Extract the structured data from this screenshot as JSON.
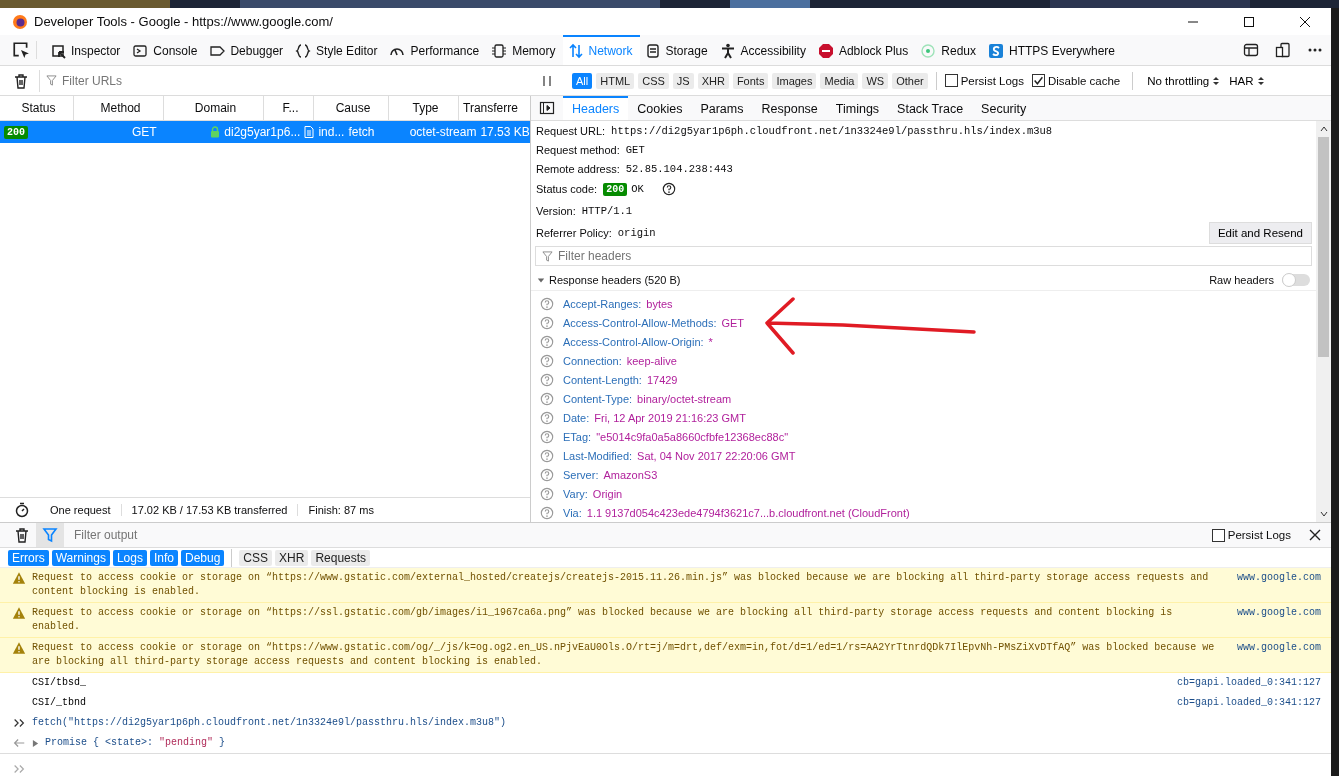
{
  "window": {
    "title": "Developer Tools - Google - https://www.google.com/"
  },
  "tool_tabs": [
    {
      "label": "Inspector",
      "selected": false
    },
    {
      "label": "Console",
      "selected": false
    },
    {
      "label": "Debugger",
      "selected": false
    },
    {
      "label": "Style Editor",
      "selected": false
    },
    {
      "label": "Performance",
      "selected": false
    },
    {
      "label": "Memory",
      "selected": false
    },
    {
      "label": "Network",
      "selected": true
    },
    {
      "label": "Storage",
      "selected": false
    },
    {
      "label": "Accessibility",
      "selected": false
    },
    {
      "label": "Adblock Plus",
      "selected": false
    },
    {
      "label": "Redux",
      "selected": false
    },
    {
      "label": "HTTPS Everywhere",
      "selected": false
    }
  ],
  "network_toolbar": {
    "filter": {
      "placeholder": "Filter URLs"
    },
    "type_filters": [
      {
        "label": "All",
        "selected": true
      },
      {
        "label": "HTML",
        "selected": false
      },
      {
        "label": "CSS",
        "selected": false
      },
      {
        "label": "JS",
        "selected": false
      },
      {
        "label": "XHR",
        "selected": false
      },
      {
        "label": "Fonts",
        "selected": false
      },
      {
        "label": "Images",
        "selected": false
      },
      {
        "label": "Media",
        "selected": false
      },
      {
        "label": "WS",
        "selected": false
      },
      {
        "label": "Other",
        "selected": false
      }
    ],
    "options": [
      {
        "label": "Persist Logs",
        "checked": false
      },
      {
        "label": "Disable cache",
        "checked": true
      }
    ],
    "throttling": "No throttling",
    "har": "HAR"
  },
  "request_table": {
    "columns": [
      "Status",
      "Method",
      "Domain",
      "F...",
      "Cause",
      "Type",
      "Transferre"
    ],
    "rows": [
      {
        "status": "200",
        "method": "GET",
        "domain": "di2g5yar1p6...",
        "file": "ind...",
        "cause": "fetch",
        "type": "octet-stream",
        "transferred": "17.53 KB",
        "selected": true
      }
    ]
  },
  "status_bar": [
    "One request",
    "17.02 KB / 17.53 KB transferred",
    "Finish: 87 ms"
  ],
  "details": {
    "tabs": [
      {
        "label": "Headers",
        "selected": true
      },
      {
        "label": "Cookies",
        "selected": false
      },
      {
        "label": "Params",
        "selected": false
      },
      {
        "label": "Response",
        "selected": false
      },
      {
        "label": "Timings",
        "selected": false
      },
      {
        "label": "Stack Trace",
        "selected": false
      },
      {
        "label": "Security",
        "selected": false
      }
    ],
    "summary": [
      {
        "kind": "text",
        "label": "Request URL:",
        "value": "https://di2g5yar1p6ph.cloudfront.net/1n3324e9l/passthru.hls/index.m3u8"
      },
      {
        "kind": "text",
        "label": "Request method:",
        "value": "GET"
      },
      {
        "kind": "text",
        "label": "Remote address:",
        "value": "52.85.104.238:443"
      },
      {
        "kind": "status",
        "label": "Status code:",
        "code": "200",
        "value": "OK"
      },
      {
        "kind": "text",
        "label": "Version:",
        "value": "HTTP/1.1"
      },
      {
        "kind": "text",
        "label": "Referrer Policy:",
        "value": "origin"
      }
    ],
    "edit_button": "Edit and Resend",
    "filter": {
      "placeholder": "Filter headers"
    },
    "response_headers": {
      "title": "Response headers (520 B)",
      "expanded": true
    },
    "raw_headers": {
      "label": "Raw headers",
      "on": false
    },
    "headers": [
      {
        "name": "Accept-Ranges:",
        "value": "bytes"
      },
      {
        "name": "Access-Control-Allow-Methods:",
        "value": "GET"
      },
      {
        "name": "Access-Control-Allow-Origin:",
        "value": "*"
      },
      {
        "name": "Connection:",
        "value": "keep-alive"
      },
      {
        "name": "Content-Length:",
        "value": "17429"
      },
      {
        "name": "Content-Type:",
        "value": "binary/octet-stream"
      },
      {
        "name": "Date:",
        "value": "Fri, 12 Apr 2019 21:16:23 GMT"
      },
      {
        "name": "ETag:",
        "value": "\"e5014c9fa0a5a8660cfbfe12368ec88c\""
      },
      {
        "name": "Last-Modified:",
        "value": "Sat, 04 Nov 2017 22:20:06 GMT"
      },
      {
        "name": "Server:",
        "value": "AmazonS3"
      },
      {
        "name": "Vary:",
        "value": "Origin"
      },
      {
        "name": "Via:",
        "value": "1.1 9137d054c423ede4794f3621c7...b.cloudfront.net (CloudFront)"
      }
    ]
  },
  "console": {
    "filter": {
      "placeholder": "Filter output"
    },
    "persist_logs": {
      "label": "Persist Logs",
      "checked": false
    },
    "level_filters": [
      {
        "label": "Errors",
        "selected": true
      },
      {
        "label": "Warnings",
        "selected": true
      },
      {
        "label": "Logs",
        "selected": true
      },
      {
        "label": "Info",
        "selected": true
      },
      {
        "label": "Debug",
        "selected": true
      },
      {
        "label": "CSS",
        "selected": false
      },
      {
        "label": "XHR",
        "selected": false
      },
      {
        "label": "Requests",
        "selected": false
      }
    ],
    "messages": [
      {
        "kind": "warning",
        "text": "Request to access cookie or storage on “https://www.gstatic.com/external_hosted/createjs/createjs-2015.11.26.min.js” was blocked because we are blocking all third-party storage access requests and content blocking is enabled.",
        "source": "www.google.com"
      },
      {
        "kind": "warning",
        "text": "Request to access cookie or storage on “https://ssl.gstatic.com/gb/images/i1_1967ca6a.png” was blocked because we are blocking all third-party storage access requests and content blocking is enabled.",
        "source": "www.google.com"
      },
      {
        "kind": "warning",
        "text": "Request to access cookie or storage on “https://www.gstatic.com/og/_/js/k=og.og2.en_US.nPjvEaU0Ols.O/rt=j/m=drt,def/exm=in,fot/d=1/ed=1/rs=AA2YrTtnrdQDk7IlEpvNh-PMsZiXvDTfAQ” was blocked because we are blocking all third-party storage access requests and content blocking is enabled.",
        "source": "www.google.com"
      },
      {
        "kind": "log",
        "text": "CSI/tbsd_",
        "source": "cb=gapi.loaded_0:341:127"
      },
      {
        "kind": "log",
        "text": "CSI/_tbnd",
        "source": "cb=gapi.loaded_0:341:127"
      },
      {
        "kind": "input",
        "text": "fetch(\"https://di2g5yar1p6ph.cloudfront.net/1n3324e9l/passthru.hls/index.m3u8\")"
      },
      {
        "kind": "result",
        "text": "Promise { <state>:",
        "value": "\"pending\"",
        "close": "}"
      }
    ]
  }
}
